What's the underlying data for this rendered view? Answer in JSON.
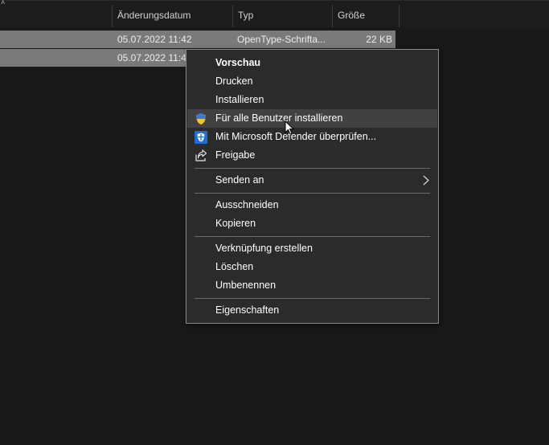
{
  "columns": {
    "date": "Änderungsdatum",
    "type": "Typ",
    "size": "Größe"
  },
  "rows": [
    {
      "date": "05.07.2022 11:42",
      "type": "OpenType-Schrifta...",
      "size": "22 KB"
    },
    {
      "date": "05.07.2022 11:4..."
    }
  ],
  "menu": {
    "items": [
      {
        "label": "Vorschau"
      },
      {
        "label": "Drucken"
      },
      {
        "label": "Installieren"
      },
      {
        "label": "Für alle Benutzer installieren",
        "icon": "uac-shield-icon"
      },
      {
        "label": "Mit Microsoft Defender überprüfen...",
        "icon": "defender-shield-icon"
      },
      {
        "label": "Freigabe",
        "icon": "share-icon"
      },
      {
        "label": "Senden an",
        "submenu": "chevron-right-icon"
      },
      {
        "label": "Ausschneiden"
      },
      {
        "label": "Kopieren"
      },
      {
        "label": "Verknüpfung erstellen"
      },
      {
        "label": "Löschen"
      },
      {
        "label": "Umbenennen"
      },
      {
        "label": "Eigenschaften"
      }
    ]
  },
  "colors": {
    "background": "#191919",
    "selected_row": "#7a7a7a",
    "menu_background": "#2b2b2b",
    "menu_hover": "#414141",
    "defender_blue": "#1f6fd1",
    "uac_yellow": "#f2c230",
    "uac_blue": "#3a7bd5"
  }
}
